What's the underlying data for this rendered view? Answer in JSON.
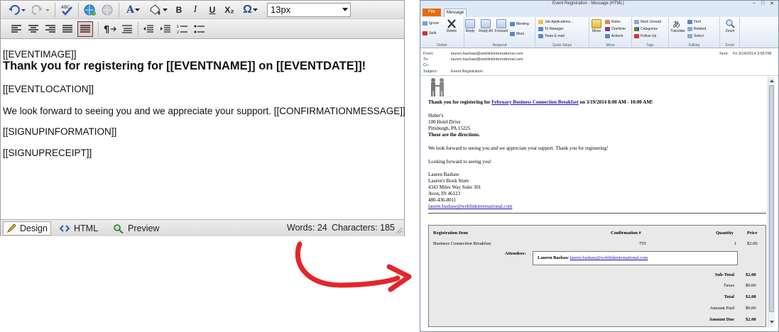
{
  "editor": {
    "font_size_value": "13px",
    "content_lines": [
      "[[EVENTIMAGE]]",
      "Thank you for registering for [[EVENTNAME]] on [[EVENTDATE]]!",
      "[[EVENTLOCATION]]",
      "We look forward to seeing you and we appreciate your support. [[CONFIRMATIONMESSAGE]]",
      "[[SIGNUPINFORMATION]]",
      "[[SIGNUPRECEIPT]]"
    ],
    "tabs": {
      "design": "Design",
      "html": "HTML",
      "preview": "Preview"
    },
    "words": "Words: 24",
    "characters": "Characters: 185",
    "toolbar_glyphs": {
      "omega": "Ω",
      "bold": "B",
      "italic": "I",
      "underline": "U",
      "subscript": "X₂",
      "font_color": "A"
    }
  },
  "arrow_color": "#e3262b",
  "outlook": {
    "window_title": "Event Registration - Message (HTML)",
    "tab_file": "File",
    "tab_message": "Message",
    "ribbon": {
      "delete": {
        "ignore": "Ignore",
        "junk": "Junk",
        "delete": "Delete",
        "label": "Delete"
      },
      "respond": {
        "reply": "Reply",
        "reply_all": "Reply All",
        "forward": "Forward",
        "meeting": "Meeting",
        "more": "More",
        "label": "Respond"
      },
      "quick_steps": {
        "items": [
          "Job Applications...",
          "To Manager",
          "Team E-mail"
        ],
        "label": "Quick Steps"
      },
      "move": {
        "move": "Move",
        "rules": "Rules",
        "onenote": "OneNote",
        "actions": "Actions",
        "label": "Move"
      },
      "tags": {
        "mark_unread": "Mark Unread",
        "categorize": "Categorize",
        "follow_up": "Follow Up",
        "label": "Tags"
      },
      "editing": {
        "translate": "Translate",
        "find": "Find",
        "related": "Related",
        "select": "Select",
        "label": "Editing"
      },
      "zoom": {
        "zoom": "Zoom",
        "label": "Zoom"
      }
    },
    "header": {
      "from_label": "From:",
      "from": "lauren.bashaw@weblinkinternational.com",
      "to_label": "To:",
      "to": "lauren.bashaw@weblinkinternational.com",
      "cc_label": "Cc:",
      "subject_label": "Subject:",
      "subject": "Event Registration",
      "sent_label": "Sent:",
      "sent": "Fri 3/14/2014 3:55 PM"
    },
    "body": {
      "thank_prefix": "Thank you for registering for ",
      "event_name": "February Business Connection Breakfast",
      "thank_suffix": " on 3/19/2014 8:00 AM - 10:00 AM!",
      "location": [
        "Huber's",
        "100 Hotel Drive",
        "Pittsburgh, PA 15225"
      ],
      "directions": "These are the directions.",
      "support": "We look forward to seeing you and we appreciate your support. Thank you for registering!",
      "looking_forward": "Looking forward to seeing you!",
      "signup": [
        "Lauren Bashaw",
        "Lauren's Book Store",
        "4343 Miles Way Suite 301",
        "Avon, IN 46123",
        "480-436-8011"
      ],
      "signup_email": "lauren.bashaw@weblinkinternational.com"
    },
    "receipt": {
      "headers": {
        "item": "Registration Item",
        "confirmation": "Confirmation #",
        "quantity": "Quantity",
        "price": "Price"
      },
      "row": {
        "item": "Business Connection Breakfast",
        "confirmation": "755",
        "quantity": "1",
        "price": "$2.00"
      },
      "attendees_label": "Attendees:",
      "attendee_name": "Lauren Bashaw",
      "attendee_email": "lauren.bashaw@weblinkinternational.com",
      "totals": [
        {
          "label": "Sub-Total",
          "value": "$2.00",
          "bold": true
        },
        {
          "label": "Taxes",
          "value": "$0.00",
          "bold": false
        },
        {
          "label": "Total",
          "value": "$2.00",
          "bold": true
        },
        {
          "label": "Amount Paid",
          "value": "$0.00",
          "bold": false
        },
        {
          "label": "Amount Due",
          "value": "$2.00",
          "bold": true
        }
      ]
    }
  }
}
